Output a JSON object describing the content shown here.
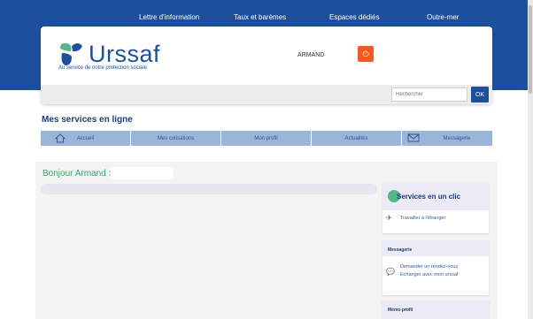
{
  "top_nav": [
    "Lettre d'information",
    "Taux et barèmes",
    "Espaces dédiés",
    "Outre-mer"
  ],
  "logo": {
    "word": "Urssaf",
    "tagline": "Au service de notre protection sociale"
  },
  "header": {
    "user_name": "ARMAND",
    "logout_icon": "power-icon"
  },
  "search": {
    "placeholder": "Rechercher",
    "button_label": "OK"
  },
  "section_title": "Mes services en ligne",
  "menu": [
    {
      "icon": "home-icon",
      "label": "Accueil"
    },
    {
      "label": "Mes cotisations"
    },
    {
      "label": "Mon profil"
    },
    {
      "label": "Actualités"
    },
    {
      "icon": "mail-icon",
      "label": "Messagerie"
    }
  ],
  "greeting": "Bonjour Armand :",
  "sidebar": {
    "services_title": "Services en un clic",
    "travel_link": "Travailler à l'étranger",
    "messaging_title": "Messagerie",
    "appointment_line1": "Demander un rendez-vous",
    "appointment_line2": "Echanger avec mon urssaf",
    "memo_title": "Mémo profil"
  },
  "colors": {
    "brand_blue": "#1d4f9c",
    "accent_orange": "#f05a22",
    "accent_green": "#3aa86a"
  }
}
